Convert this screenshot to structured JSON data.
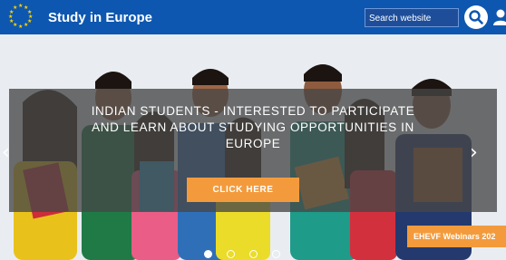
{
  "header": {
    "title": "Study in Europe",
    "search_placeholder": "Search website",
    "logo_icon": "eu-stars-icon",
    "search_icon": "search-icon",
    "user_icon": "user-icon",
    "bar_color": "#0d57b0"
  },
  "hero": {
    "headline_line1": "INDIAN STUDENTS - INTERESTED TO PARTICIPATE",
    "headline_line2": "AND LEARN ABOUT STUDYING OPPORTUNITIES IN",
    "headline_line3": "EUROPE",
    "cta_label": "CLICK HERE",
    "cta_color": "#f39b3c",
    "prev_icon": "chevron-left-icon",
    "next_icon": "chevron-right-icon",
    "slide_count": 4,
    "active_slide": 1,
    "webinar_label": "EHEVF Webinars 202"
  }
}
